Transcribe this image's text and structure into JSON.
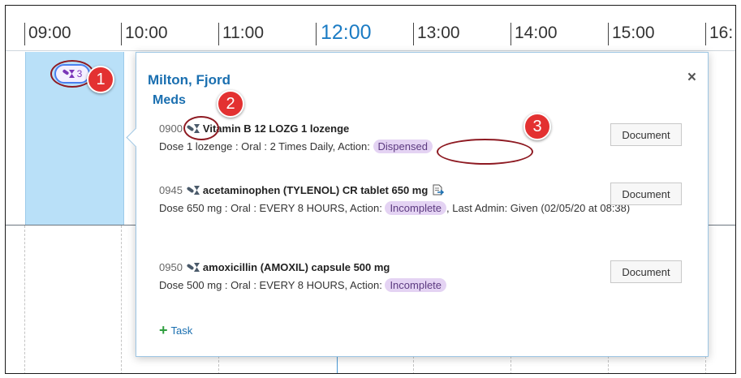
{
  "timeline": {
    "hours": [
      "09:00",
      "10:00",
      "11:00",
      "12:00",
      "13:00",
      "14:00",
      "15:00",
      "16:"
    ],
    "current_hour_index": 3
  },
  "task_badge": {
    "count": "3"
  },
  "callouts": [
    "1",
    "2",
    "3"
  ],
  "popover": {
    "patient_name": "Milton, Fjord",
    "section_title": "Meds",
    "close_label": "×",
    "meds": [
      {
        "time": "0900",
        "name": "Vitamin B 12 LOZG 1 lozenge",
        "details_prefix": "Dose 1 lozenge : Oral : 2 Times Daily, Action:",
        "status": "Dispensed",
        "details_suffix": "",
        "button_label": "Document"
      },
      {
        "time": "0945",
        "name": "acetaminophen (TYLENOL) CR tablet 650 mg",
        "details_prefix": "Dose 650 mg : Oral : EVERY 8 HOURS, Action:",
        "status": "Incomplete",
        "details_suffix": ", Last Admin: Given (02/05/20 at 08:38)",
        "button_label": "Document"
      },
      {
        "time": "0950",
        "name": "amoxicillin (AMOXIL) capsule 500 mg",
        "details_prefix": "Dose 500 mg : Oral : EVERY 8 HOURS, Action:",
        "status": "Incomplete",
        "details_suffix": "",
        "button_label": "Document"
      }
    ],
    "task_link_label": "Task"
  },
  "colors": {
    "accent_blue": "#1a6fb0",
    "highlight": "#b9e0f8",
    "status_pill": "#e4d3f3",
    "callout_red": "#e33131",
    "annotation_ring": "#8e1a22",
    "plus_green": "#2e9e3e"
  },
  "icons": {
    "med_icon": "pill-hourglass-icon",
    "document_icon": "document-arrow-icon",
    "plus_icon": "plus-icon",
    "close_icon": "close-icon"
  }
}
